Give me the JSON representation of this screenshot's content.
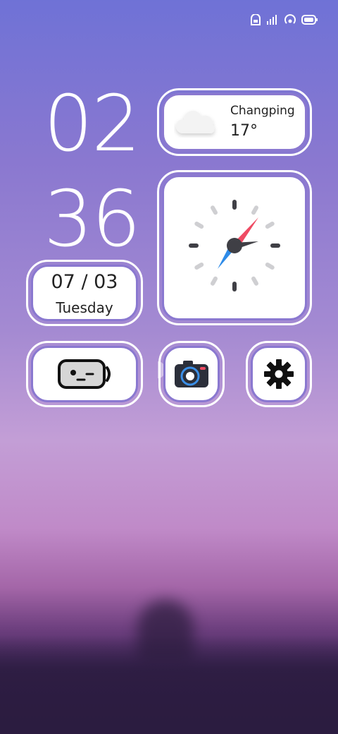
{
  "status_bar": {
    "icons": [
      "hd-icon",
      "signal-icon",
      "hotspot-icon",
      "battery-icon"
    ],
    "battery_level": "100"
  },
  "time": {
    "hour": "02",
    "minute": "36"
  },
  "date_widget": {
    "date": "07 / 03",
    "weekday": "Tuesday"
  },
  "weather_widget": {
    "city": "Changping",
    "temperature": "17°",
    "condition_icon": "cloud-icon"
  },
  "clock_widget": {
    "icon": "analog-clock-icon"
  },
  "apps": [
    {
      "name": "robot-app",
      "icon": "robot-face-icon"
    },
    {
      "name": "camera-app",
      "icon": "camera-icon"
    },
    {
      "name": "settings-app",
      "icon": "gear-icon"
    }
  ],
  "colors": {
    "accent_border": "#8a78d0",
    "compass_red": "#ef4b63",
    "compass_blue": "#2e8be8"
  }
}
